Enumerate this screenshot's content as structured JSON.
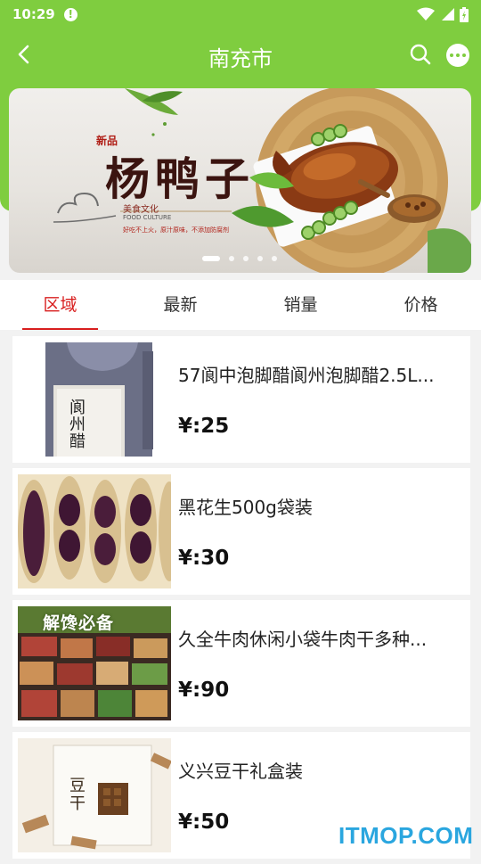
{
  "status_bar": {
    "time": "10:29",
    "alert_glyph": "!"
  },
  "nav": {
    "title": "南充市"
  },
  "banner": {
    "tag": "新品",
    "title": "杨鸭子",
    "culture_cn": "美食文化",
    "culture_en": "FOOD CULTURE",
    "slogan": "好吃不上火，原汁原味，不添加防腐剂",
    "slide_count": 5,
    "active_slide": 1
  },
  "tabs": [
    {
      "label": "区域",
      "active": true
    },
    {
      "label": "最新",
      "active": false
    },
    {
      "label": "销量",
      "active": false
    },
    {
      "label": "价格",
      "active": false
    }
  ],
  "products": [
    {
      "name": "57阆中泡脚醋阆州泡脚醋2.5L...",
      "price": "¥:25",
      "image_text": "阆州醋"
    },
    {
      "name": "黑花生500g袋装",
      "price": "¥:30"
    },
    {
      "name": "久全牛肉休闲小袋牛肉干多种...",
      "price": "¥:90",
      "image_text": "解馋必备"
    },
    {
      "name": "义兴豆干礼盒装",
      "price": "¥:50",
      "image_text": "豆干"
    }
  ],
  "watermark": "ITMOP.COM",
  "colors": {
    "brand_green": "#7fcd3f",
    "active_tab": "#d81e1e",
    "watermark": "#2aa6df"
  },
  "icons": [
    "back-arrow-icon",
    "search-icon",
    "more-dots-icon",
    "wifi-icon",
    "signal-icon",
    "battery-icon",
    "alert-icon"
  ]
}
